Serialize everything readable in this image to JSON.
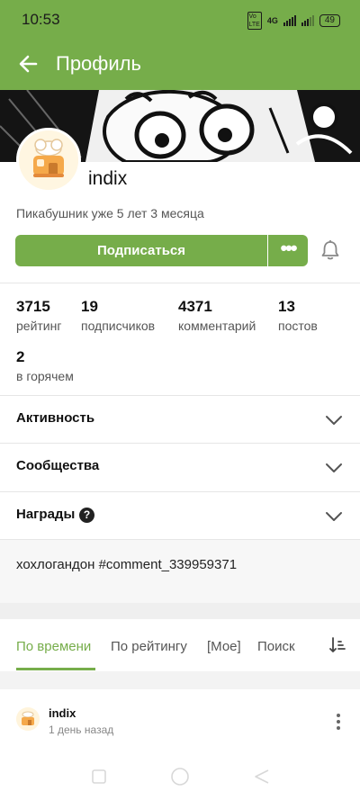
{
  "status_bar": {
    "time": "10:53",
    "network": "4G",
    "battery": "49"
  },
  "app_bar": {
    "title": "Профиль",
    "back_icon": "arrow-left-icon"
  },
  "profile": {
    "username": "indix",
    "member_since": "Пикабушник уже 5 лет 3 месяца",
    "subscribe_label": "Подписаться",
    "more_label": "•••",
    "bell_icon": "bell-icon"
  },
  "stats": [
    {
      "value": "3715",
      "label": "рейтинг"
    },
    {
      "value": "19",
      "label": "подписчиков"
    },
    {
      "value": "4371",
      "label": "комментарий"
    },
    {
      "value": "13",
      "label": "постов"
    },
    {
      "value": "2",
      "label": "в горячем"
    }
  ],
  "sections": [
    {
      "label": "Активность",
      "icon": "chevron-down-icon"
    },
    {
      "label": "Сообщества",
      "icon": "chevron-down-icon"
    },
    {
      "label": "Награды",
      "icon": "chevron-down-icon",
      "help_icon": "question-circle-icon",
      "help_text": "?"
    }
  ],
  "note": {
    "text": "хохлогандон #comment_339959371"
  },
  "tabs": {
    "items": [
      {
        "label": "По времени",
        "active": true
      },
      {
        "label": "По рейтингу",
        "active": false
      },
      {
        "label": "[Мое]",
        "active": false
      },
      {
        "label": "Поиск",
        "active": false
      }
    ],
    "sort_icon": "sort-icon"
  },
  "post": {
    "author": "indix",
    "time": "1 день назад",
    "menu_icon": "more-vertical-icon"
  },
  "colors": {
    "accent": "#76ad4a",
    "text": "#111111",
    "muted": "#555555"
  }
}
